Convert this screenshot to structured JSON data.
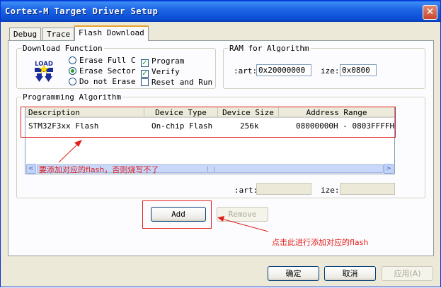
{
  "window": {
    "title": "Cortex-M Target Driver Setup",
    "close_glyph": "✕"
  },
  "tabs": [
    {
      "label": "Debug",
      "active": false
    },
    {
      "label": "Trace",
      "active": false
    },
    {
      "label": "Flash Download",
      "active": true
    }
  ],
  "download_function": {
    "legend": "Download Function",
    "icon_text": "LOAD",
    "options": [
      {
        "label": "Erase Full C",
        "selected": false
      },
      {
        "label": "Erase Sector",
        "selected": true
      },
      {
        "label": "Do not Erase",
        "selected": false
      }
    ],
    "checks": [
      {
        "label": "Program",
        "checked": true
      },
      {
        "label": "Verify",
        "checked": true
      },
      {
        "label": "Reset and Run",
        "checked": false
      }
    ],
    "check_glyph": "✓"
  },
  "ram": {
    "legend": "RAM for Algorithm",
    "start_label": ":art:",
    "start_value": "0x20000000",
    "size_label": "ize:",
    "size_value": "0x0800"
  },
  "programming": {
    "legend": "Programming Algorithm",
    "columns": [
      "Description",
      "Device Type",
      "Device Size",
      "Address Range"
    ],
    "rows": [
      {
        "description": "STM32F3xx Flash",
        "device_type": "On-chip Flash",
        "device_size": "256k",
        "address_range": "08000000H - 0803FFFFH"
      }
    ],
    "start_label": ":art:",
    "start_value": "",
    "size_label": "ize:",
    "size_value": ""
  },
  "scroll": {
    "left_glyph": "<",
    "right_glyph": ">"
  },
  "buttons": {
    "add": "Add",
    "remove": "Remove",
    "ok": "确定",
    "cancel": "取消",
    "apply": "应用(A)"
  },
  "annotations": {
    "note_list": "要添加对应的flash，否则烧写不了",
    "note_add": "点击此进行添加对应的flash",
    "color": "#e0201c"
  }
}
